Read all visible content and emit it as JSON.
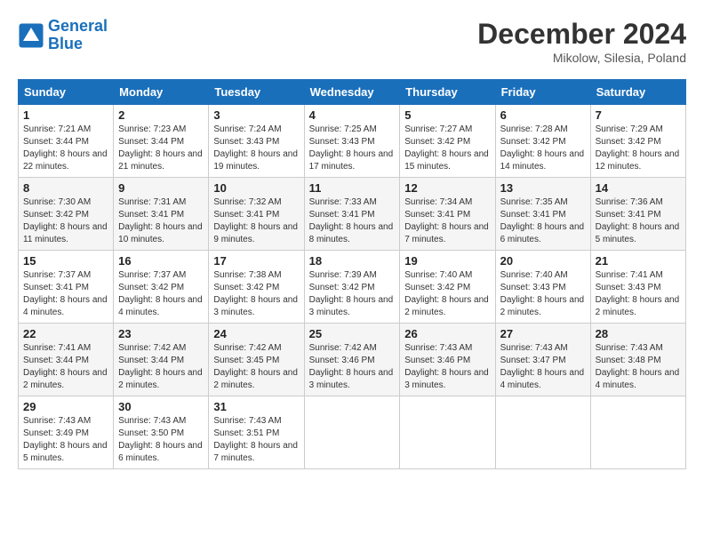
{
  "header": {
    "logo_line1": "General",
    "logo_line2": "Blue",
    "month": "December 2024",
    "location": "Mikolow, Silesia, Poland"
  },
  "weekdays": [
    "Sunday",
    "Monday",
    "Tuesday",
    "Wednesday",
    "Thursday",
    "Friday",
    "Saturday"
  ],
  "weeks": [
    [
      {
        "day": "1",
        "sunrise": "7:21 AM",
        "sunset": "3:44 PM",
        "daylight": "8 hours and 22 minutes."
      },
      {
        "day": "2",
        "sunrise": "7:23 AM",
        "sunset": "3:44 PM",
        "daylight": "8 hours and 21 minutes."
      },
      {
        "day": "3",
        "sunrise": "7:24 AM",
        "sunset": "3:43 PM",
        "daylight": "8 hours and 19 minutes."
      },
      {
        "day": "4",
        "sunrise": "7:25 AM",
        "sunset": "3:43 PM",
        "daylight": "8 hours and 17 minutes."
      },
      {
        "day": "5",
        "sunrise": "7:27 AM",
        "sunset": "3:42 PM",
        "daylight": "8 hours and 15 minutes."
      },
      {
        "day": "6",
        "sunrise": "7:28 AM",
        "sunset": "3:42 PM",
        "daylight": "8 hours and 14 minutes."
      },
      {
        "day": "7",
        "sunrise": "7:29 AM",
        "sunset": "3:42 PM",
        "daylight": "8 hours and 12 minutes."
      }
    ],
    [
      {
        "day": "8",
        "sunrise": "7:30 AM",
        "sunset": "3:42 PM",
        "daylight": "8 hours and 11 minutes."
      },
      {
        "day": "9",
        "sunrise": "7:31 AM",
        "sunset": "3:41 PM",
        "daylight": "8 hours and 10 minutes."
      },
      {
        "day": "10",
        "sunrise": "7:32 AM",
        "sunset": "3:41 PM",
        "daylight": "8 hours and 9 minutes."
      },
      {
        "day": "11",
        "sunrise": "7:33 AM",
        "sunset": "3:41 PM",
        "daylight": "8 hours and 8 minutes."
      },
      {
        "day": "12",
        "sunrise": "7:34 AM",
        "sunset": "3:41 PM",
        "daylight": "8 hours and 7 minutes."
      },
      {
        "day": "13",
        "sunrise": "7:35 AM",
        "sunset": "3:41 PM",
        "daylight": "8 hours and 6 minutes."
      },
      {
        "day": "14",
        "sunrise": "7:36 AM",
        "sunset": "3:41 PM",
        "daylight": "8 hours and 5 minutes."
      }
    ],
    [
      {
        "day": "15",
        "sunrise": "7:37 AM",
        "sunset": "3:41 PM",
        "daylight": "8 hours and 4 minutes."
      },
      {
        "day": "16",
        "sunrise": "7:37 AM",
        "sunset": "3:42 PM",
        "daylight": "8 hours and 4 minutes."
      },
      {
        "day": "17",
        "sunrise": "7:38 AM",
        "sunset": "3:42 PM",
        "daylight": "8 hours and 3 minutes."
      },
      {
        "day": "18",
        "sunrise": "7:39 AM",
        "sunset": "3:42 PM",
        "daylight": "8 hours and 3 minutes."
      },
      {
        "day": "19",
        "sunrise": "7:40 AM",
        "sunset": "3:42 PM",
        "daylight": "8 hours and 2 minutes."
      },
      {
        "day": "20",
        "sunrise": "7:40 AM",
        "sunset": "3:43 PM",
        "daylight": "8 hours and 2 minutes."
      },
      {
        "day": "21",
        "sunrise": "7:41 AM",
        "sunset": "3:43 PM",
        "daylight": "8 hours and 2 minutes."
      }
    ],
    [
      {
        "day": "22",
        "sunrise": "7:41 AM",
        "sunset": "3:44 PM",
        "daylight": "8 hours and 2 minutes."
      },
      {
        "day": "23",
        "sunrise": "7:42 AM",
        "sunset": "3:44 PM",
        "daylight": "8 hours and 2 minutes."
      },
      {
        "day": "24",
        "sunrise": "7:42 AM",
        "sunset": "3:45 PM",
        "daylight": "8 hours and 2 minutes."
      },
      {
        "day": "25",
        "sunrise": "7:42 AM",
        "sunset": "3:46 PM",
        "daylight": "8 hours and 3 minutes."
      },
      {
        "day": "26",
        "sunrise": "7:43 AM",
        "sunset": "3:46 PM",
        "daylight": "8 hours and 3 minutes."
      },
      {
        "day": "27",
        "sunrise": "7:43 AM",
        "sunset": "3:47 PM",
        "daylight": "8 hours and 4 minutes."
      },
      {
        "day": "28",
        "sunrise": "7:43 AM",
        "sunset": "3:48 PM",
        "daylight": "8 hours and 4 minutes."
      }
    ],
    [
      {
        "day": "29",
        "sunrise": "7:43 AM",
        "sunset": "3:49 PM",
        "daylight": "8 hours and 5 minutes."
      },
      {
        "day": "30",
        "sunrise": "7:43 AM",
        "sunset": "3:50 PM",
        "daylight": "8 hours and 6 minutes."
      },
      {
        "day": "31",
        "sunrise": "7:43 AM",
        "sunset": "3:51 PM",
        "daylight": "8 hours and 7 minutes."
      },
      null,
      null,
      null,
      null
    ]
  ]
}
